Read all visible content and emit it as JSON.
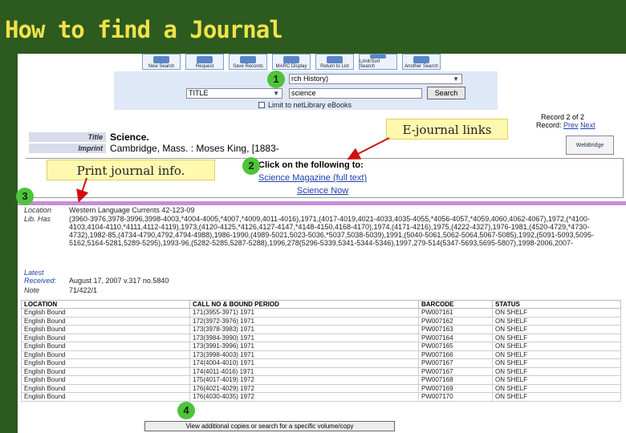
{
  "slide_title": "How to find a Journal",
  "toolbar": {
    "buttons": [
      "New Search",
      "Request",
      "Save Records",
      "MARC Display",
      "Return to List",
      "Limit/Sort Search",
      "Another Search"
    ]
  },
  "search": {
    "history": "rch History)",
    "field": "TITLE",
    "query": "science",
    "search_button": "Search",
    "limit_label": "Limit to netLibrary eBooks"
  },
  "record_nav": {
    "label": "Record 2 of 2",
    "record_label": "Record:",
    "prev": "Prev",
    "next": "Next"
  },
  "webbridge": "WebBridge",
  "fields": {
    "title_label": "Title",
    "title_value": "Science.",
    "imprint_label": "Imprint",
    "imprint_value": "Cambridge, Mass. : Moses King, [1883-"
  },
  "links": {
    "heading": "Click on the following to:",
    "link1": "Science Magazine (full text)",
    "link2": "Science Now"
  },
  "holdings": {
    "location_label": "Location",
    "location_value": "Western Language Currents      42-123-09",
    "libhas_label": "Lib. Has",
    "libhas_value": "(3960-3976,3978-3996,3998-4003,*4004-4005,*4007,*4009,4011-4016),1971,(4017-4019,4021-4033,4035-4055,*4056-4057,*4059,4060,4062-4067),1972,(*4100-4103,4104-4110,*4111,4112-4119),1973,(4120-4125,*4126,4127-4147,*4148-4150,4168-4170),1974,(4171-4216),1975,(4222-4327),1976-1981,(4520-4729,*4730-4732),1982-85,(4734-4790,4792,4794-4988),1986-1990,(4989-5021,5023-5036,*5037,5038-5039),1991,(5040-5061,5062-5064,5067-5085),1992,(5091-5093,5095-5162,5164-5281,5289-5295),1993-96,(5282-5285,5287-5288),1996,278(5296-5339,5341-5344-5346),1997,279-514(5347-5693,5695-5807),1998-2006,2007-",
    "latest_label": "Latest Received:",
    "latest_value": "August 17, 2007 v.317 no.5840",
    "note_label": "Note",
    "note_value": "71/422/1"
  },
  "table": {
    "headers": [
      "LOCATION",
      "CALL NO & BOUND PERIOD",
      "BARCODE",
      "STATUS"
    ],
    "rows": [
      [
        "English Bound",
        "171(3955-3971) 1971",
        "PW007161",
        "ON SHELF"
      ],
      [
        "English Bound",
        "172(3972-3976) 1971",
        "PW007162",
        "ON SHELF"
      ],
      [
        "English Bound",
        "173(3978-3983) 1971",
        "PW007163",
        "ON SHELF"
      ],
      [
        "English Bound",
        "173(3984-3990) 1971",
        "PW007164",
        "ON SHELF"
      ],
      [
        "English Bound",
        "173(3991-3996) 1971",
        "PW007165",
        "ON SHELF"
      ],
      [
        "English Bound",
        "173(3998-4003) 1971",
        "PW007166",
        "ON SHELF"
      ],
      [
        "English Bound",
        "174(4004-4010) 1971",
        "PW007167",
        "ON SHELF"
      ],
      [
        "English Bound",
        "174(4011-4016) 1971",
        "PW007167",
        "ON SHELF"
      ],
      [
        "English Bound",
        "175(4017-4019) 1972",
        "PW007168",
        "ON SHELF"
      ],
      [
        "English Bound",
        "176(4021-4029) 1972",
        "PW007169",
        "ON SHELF"
      ],
      [
        "English Bound",
        "176(4030-4035) 1972",
        "PW007170",
        "ON SHELF"
      ]
    ],
    "more_button": "View additional copies or search for a specific volume/copy"
  },
  "callouts": {
    "ejournal": "E-journal links",
    "print_info": "Print journal info."
  },
  "numbers": [
    "1",
    "2",
    "3",
    "4"
  ]
}
